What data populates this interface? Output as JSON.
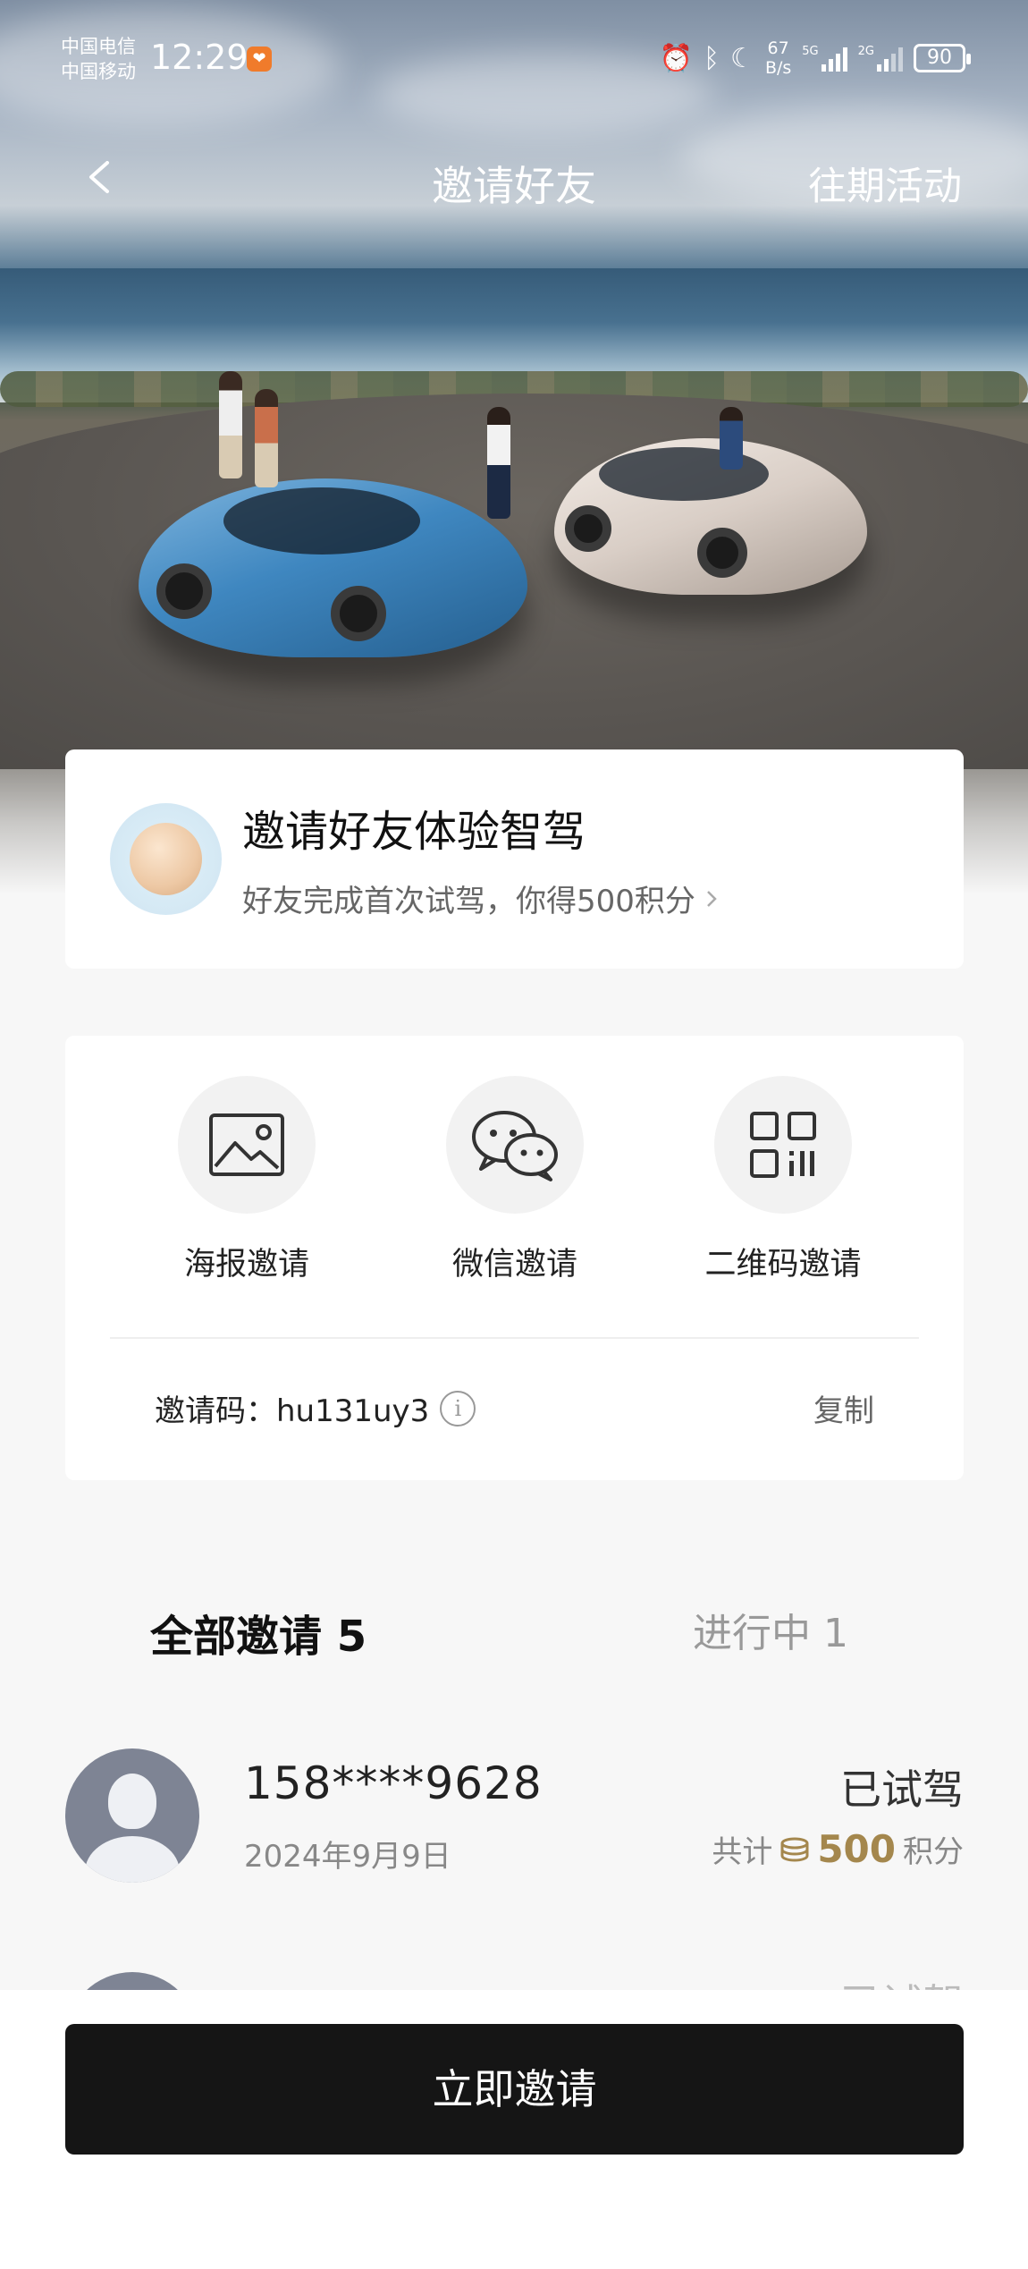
{
  "status_bar": {
    "carrier_1": "中国电信",
    "carrier_2": "中国移动",
    "time": "12:29",
    "net_speed_value": "67",
    "net_speed_unit": "B/s",
    "sig1_label": "5G",
    "sig2_label": "2G",
    "battery": "90"
  },
  "nav": {
    "title": "邀请好友",
    "right_link": "往期活动"
  },
  "promo": {
    "title": "邀请好友体验智驾",
    "subtitle": "好友完成首次试驾，你得500积分"
  },
  "share": {
    "options": [
      {
        "label": "海报邀请",
        "icon": "image-icon"
      },
      {
        "label": "微信邀请",
        "icon": "wechat-icon"
      },
      {
        "label": "二维码邀请",
        "icon": "qrcode-icon"
      }
    ],
    "invite_code_label": "邀请码：hu131uy3",
    "copy_label": "复制"
  },
  "tabs": {
    "all": "全部邀请 5",
    "in_progress": "进行中 1"
  },
  "invites": [
    {
      "phone": "158****9628",
      "date": "2024年9月9日",
      "status": "已试驾",
      "points_prefix": "共计",
      "points_value": "500",
      "points_suffix": "积分"
    },
    {
      "status": "已试驾"
    }
  ],
  "cta": {
    "label": "立即邀请"
  },
  "colors": {
    "accent_gold": "#a4874d",
    "cta_background": "#151515",
    "page_background": "#f7f7f7"
  }
}
